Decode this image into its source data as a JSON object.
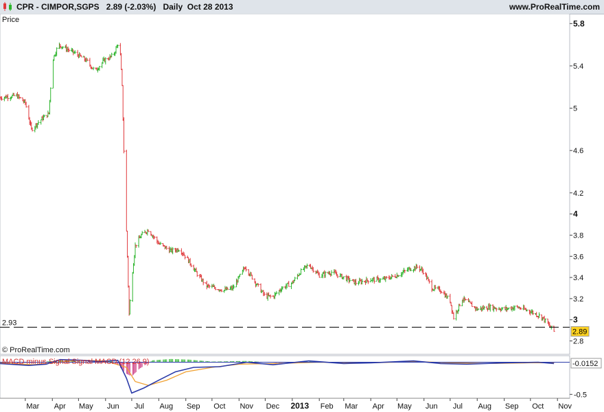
{
  "header": {
    "symbol": "CPR - CIMPOR,SGPS",
    "last_price": "2.89",
    "change": "(-2.03%)",
    "period": "Daily",
    "date": "Oct 28 2013",
    "site": "www.ProRealTime.com",
    "icon": "candlestick-chart-icon"
  },
  "price_panel": {
    "label": "Price",
    "reference_line_value": "2.93",
    "last_price_badge": "2.89",
    "copyright": "© ProRealTime.com"
  },
  "macd_panel": {
    "label": "MACD minus Signal Signal MACD (12 26 9)",
    "last_value_badge": "-0.0152"
  },
  "colors": {
    "up": "#2db52d",
    "down": "#e0383b",
    "reference_line": "#000000",
    "badge_price": "#ffd21f",
    "macd_line": "#2a3aa8",
    "signal_line": "#f0a030",
    "histogram_up": "#4cc04c",
    "histogram_down": "#d04a8c",
    "header_bg": "#dfe4ea",
    "panel_bg": "#ffffff"
  },
  "chart_data": [
    {
      "type": "bar",
      "subtype": "ohlc",
      "title": "Price",
      "ylim": [
        2.68,
        5.88
      ],
      "yticks": [
        "5.8",
        "5.4",
        "5",
        "4.6",
        "4.2",
        "4",
        "3.8",
        "3.6",
        "3.4",
        "3.2",
        "3",
        "2.8"
      ],
      "xticks": [
        "Mar",
        "Apr",
        "May",
        "Jun",
        "Jul",
        "Aug",
        "Sep",
        "Oct",
        "Nov",
        "Dec",
        "2013",
        "Feb",
        "Mar",
        "Apr",
        "May",
        "Jun",
        "Jul",
        "Aug",
        "Sep",
        "Oct",
        "Nov"
      ],
      "x_range": [
        "2012-02-01",
        "2013-11-15"
      ],
      "series": [
        {
          "values": [
            [
              "2012-02-01",
              5.1
            ],
            [
              "2012-02-20",
              5.12
            ],
            [
              "2012-03-01",
              5.05
            ],
            [
              "2012-03-08",
              4.8
            ],
            [
              "2012-03-20",
              4.9
            ],
            [
              "2012-03-28",
              4.95
            ],
            [
              "2012-04-01",
              5.45
            ],
            [
              "2012-04-08",
              5.6
            ],
            [
              "2012-04-20",
              5.55
            ],
            [
              "2012-05-01",
              5.5
            ],
            [
              "2012-05-10",
              5.45
            ],
            [
              "2012-05-20",
              5.35
            ],
            [
              "2012-05-30",
              5.45
            ],
            [
              "2012-06-10",
              5.5
            ],
            [
              "2012-06-17",
              5.65
            ],
            [
              "2012-06-20",
              5.2
            ],
            [
              "2012-06-23",
              4.3
            ],
            [
              "2012-06-26",
              3.6
            ],
            [
              "2012-06-28",
              3.05
            ],
            [
              "2012-06-30",
              3.3
            ],
            [
              "2012-07-05",
              3.7
            ],
            [
              "2012-07-12",
              3.8
            ],
            [
              "2012-07-20",
              3.85
            ],
            [
              "2012-08-01",
              3.72
            ],
            [
              "2012-08-15",
              3.65
            ],
            [
              "2012-08-25",
              3.67
            ],
            [
              "2012-09-05",
              3.55
            ],
            [
              "2012-09-15",
              3.42
            ],
            [
              "2012-09-25",
              3.32
            ],
            [
              "2012-10-05",
              3.3
            ],
            [
              "2012-10-15",
              3.28
            ],
            [
              "2012-10-25",
              3.3
            ],
            [
              "2012-11-01",
              3.4
            ],
            [
              "2012-11-08",
              3.5
            ],
            [
              "2012-11-20",
              3.35
            ],
            [
              "2012-12-01",
              3.22
            ],
            [
              "2012-12-10",
              3.22
            ],
            [
              "2012-12-20",
              3.3
            ],
            [
              "2013-01-01",
              3.35
            ],
            [
              "2013-01-10",
              3.45
            ],
            [
              "2013-01-20",
              3.52
            ],
            [
              "2013-02-01",
              3.42
            ],
            [
              "2013-02-15",
              3.45
            ],
            [
              "2013-03-01",
              3.4
            ],
            [
              "2013-03-15",
              3.35
            ],
            [
              "2013-04-01",
              3.38
            ],
            [
              "2013-04-15",
              3.38
            ],
            [
              "2013-05-01",
              3.42
            ],
            [
              "2013-05-15",
              3.48
            ],
            [
              "2013-05-25",
              3.5
            ],
            [
              "2013-06-01",
              3.45
            ],
            [
              "2013-06-10",
              3.3
            ],
            [
              "2013-06-20",
              3.28
            ],
            [
              "2013-07-01",
              3.18
            ],
            [
              "2013-07-05",
              3.02
            ],
            [
              "2013-07-15",
              3.2
            ],
            [
              "2013-08-01",
              3.1
            ],
            [
              "2013-08-15",
              3.12
            ],
            [
              "2013-09-01",
              3.1
            ],
            [
              "2013-09-15",
              3.12
            ],
            [
              "2013-10-01",
              3.08
            ],
            [
              "2013-10-15",
              3.02
            ],
            [
              "2013-10-22",
              2.95
            ],
            [
              "2013-10-28",
              2.89
            ]
          ]
        }
      ],
      "reference_line": 2.93,
      "last": 2.89
    },
    {
      "type": "line",
      "title": "MACD minus Signal Signal MACD (12 26 9)",
      "ylim": [
        -0.55,
        0.08
      ],
      "yticks": [
        "-0.5"
      ],
      "series": [
        {
          "name": "MACD",
          "values": [
            [
              "2012-02-01",
              -0.02
            ],
            [
              "2012-03-05",
              -0.05
            ],
            [
              "2012-03-25",
              -0.03
            ],
            [
              "2012-04-10",
              0.04
            ],
            [
              "2012-05-05",
              0.03
            ],
            [
              "2012-05-25",
              0.01
            ],
            [
              "2012-06-15",
              0.03
            ],
            [
              "2012-06-25",
              -0.25
            ],
            [
              "2012-07-01",
              -0.48
            ],
            [
              "2012-07-15",
              -0.4
            ],
            [
              "2012-08-01",
              -0.28
            ],
            [
              "2012-08-20",
              -0.15
            ],
            [
              "2012-09-10",
              -0.08
            ],
            [
              "2012-10-10",
              -0.07
            ],
            [
              "2012-11-10",
              0.0
            ],
            [
              "2012-12-10",
              -0.04
            ],
            [
              "2013-01-20",
              0.02
            ],
            [
              "2013-03-01",
              -0.02
            ],
            [
              "2013-04-01",
              -0.01
            ],
            [
              "2013-05-20",
              0.02
            ],
            [
              "2013-06-20",
              -0.02
            ],
            [
              "2013-07-20",
              -0.03
            ],
            [
              "2013-09-01",
              -0.01
            ],
            [
              "2013-10-10",
              0.0
            ],
            [
              "2013-10-28",
              -0.02
            ]
          ]
        },
        {
          "name": "Signal",
          "values": [
            [
              "2012-02-01",
              -0.01
            ],
            [
              "2012-03-10",
              -0.04
            ],
            [
              "2012-04-01",
              -0.01
            ],
            [
              "2012-05-01",
              0.03
            ],
            [
              "2012-06-01",
              0.02
            ],
            [
              "2012-06-25",
              -0.08
            ],
            [
              "2012-07-05",
              -0.3
            ],
            [
              "2012-07-20",
              -0.36
            ],
            [
              "2012-08-10",
              -0.28
            ],
            [
              "2012-09-01",
              -0.15
            ],
            [
              "2012-10-01",
              -0.08
            ],
            [
              "2012-11-01",
              -0.03
            ],
            [
              "2012-12-15",
              -0.02
            ],
            [
              "2013-02-01",
              0.0
            ],
            [
              "2013-04-01",
              -0.01
            ],
            [
              "2013-05-25",
              0.01
            ],
            [
              "2013-07-01",
              -0.01
            ],
            [
              "2013-08-15",
              -0.02
            ],
            [
              "2013-10-01",
              -0.01
            ],
            [
              "2013-10-28",
              -0.01
            ]
          ]
        },
        {
          "name": "MACD minus Signal",
          "type": "bar",
          "values": [
            [
              "2012-02-15",
              -0.01
            ],
            [
              "2012-03-10",
              -0.01
            ],
            [
              "2012-04-01",
              0.02
            ],
            [
              "2012-04-20",
              0.03
            ],
            [
              "2012-05-10",
              0.0
            ],
            [
              "2012-06-10",
              0.02
            ],
            [
              "2012-06-25",
              -0.18
            ],
            [
              "2012-07-01",
              -0.22
            ],
            [
              "2012-07-10",
              -0.1
            ],
            [
              "2012-07-25",
              0.03
            ],
            [
              "2012-08-15",
              0.05
            ],
            [
              "2012-09-05",
              0.04
            ],
            [
              "2012-10-01",
              0.01
            ],
            [
              "2012-11-10",
              0.02
            ],
            [
              "2012-12-15",
              -0.01
            ],
            [
              "2013-01-20",
              0.01
            ],
            [
              "2013-03-15",
              -0.01
            ],
            [
              "2013-05-15",
              0.01
            ],
            [
              "2013-06-25",
              -0.01
            ],
            [
              "2013-08-01",
              0.0
            ],
            [
              "2013-10-01",
              0.0
            ],
            [
              "2013-10-28",
              -0.01
            ]
          ]
        }
      ],
      "last": -0.0152
    }
  ]
}
